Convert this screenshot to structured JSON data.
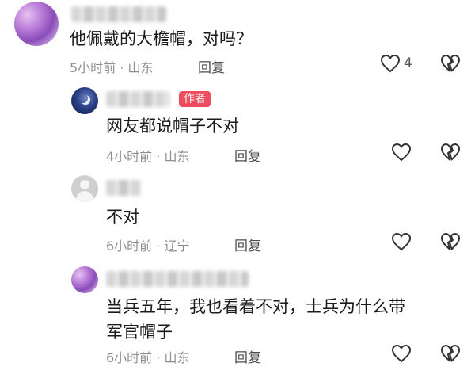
{
  "comments": [
    {
      "avatar": "purple-flower-avatar",
      "text": "他佩戴的大檐帽，对吗？",
      "meta": "5小时前 · 山东",
      "reply": "回复",
      "like_count": "4"
    },
    {
      "avatar": "night-sky-moon-avatar",
      "tag": "作者",
      "text": "网友都说帽子不对",
      "meta": "4小时前 · 山东",
      "reply": "回复"
    },
    {
      "avatar": "default-gray-avatar",
      "text": "不对",
      "meta": "6小时前 · 辽宁",
      "reply": "回复"
    },
    {
      "avatar": "purple-flower-avatar",
      "text_line1": "当兵五年，我也看着不对，士兵为什么带",
      "text_line2": "军官帽子",
      "meta": "6小时前 · 山东",
      "reply": "回复"
    }
  ],
  "icons": {
    "like": "heart-outline-icon",
    "dislike": "broken-heart-icon"
  },
  "colors": {
    "author_tag": "#f04c5c",
    "meta_text": "#8e8e8e"
  }
}
